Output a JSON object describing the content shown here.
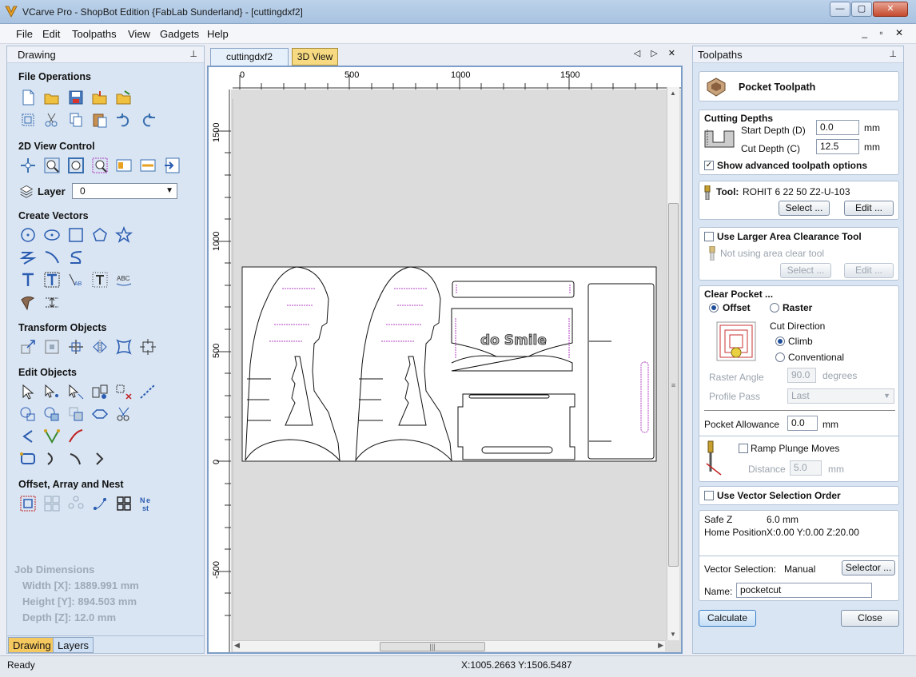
{
  "window": {
    "title": "VCarve Pro - ShopBot Edition {FabLab Sunderland} - [cuttingdxf2]",
    "min": "—",
    "max": "▢",
    "close": "✕"
  },
  "menu": [
    "File",
    "Edit",
    "Toolpaths",
    "View",
    "Gadgets",
    "Help"
  ],
  "mdi_controls": "_ ▫ ✕",
  "left_panel": {
    "title": "Drawing",
    "pin": "⊥",
    "sections": {
      "file": "File Operations",
      "view": "2D View Control",
      "vectors": "Create Vectors",
      "transform": "Transform Objects",
      "edit": "Edit Objects",
      "offset": "Offset, Array and Nest"
    },
    "layer_label": "Layer",
    "layer_value": "0",
    "job": {
      "title": "Job Dimensions",
      "width": "Width  [X]: 1889.991 mm",
      "height": "Height [Y]: 894.503 mm",
      "depth": "Depth  [Z]: 12.0 mm"
    },
    "tabs": [
      "Drawing",
      "Layers"
    ]
  },
  "doc": {
    "tabs": [
      "cuttingdxf2",
      "3D View"
    ],
    "nav": "◁ ▷ ✕",
    "ruler_top": [
      "0",
      "500",
      "1000",
      "1500"
    ],
    "ruler_left": [
      "1500",
      "1000",
      "500",
      "0",
      "-500"
    ],
    "design_text": "do Smile"
  },
  "right_panel": {
    "title": "Toolpaths",
    "header": "Pocket Toolpath",
    "cutting_depths": "Cutting Depths",
    "start_depth_label": "Start Depth (D)",
    "start_depth": "0.0",
    "cut_depth_label": "Cut Depth (C)",
    "cut_depth": "12.5",
    "unit_mm": "mm",
    "advanced": "Show advanced toolpath options",
    "tool_label": "Tool:",
    "tool_name": "ROHIT 6 22 50   Z2-U-103",
    "select_btn": "Select ...",
    "edit_btn": "Edit ...",
    "larger_area": "Use Larger Area Clearance Tool",
    "not_using": "Not using area clear tool",
    "clear_pocket": "Clear Pocket ...",
    "offset": "Offset",
    "raster": "Raster",
    "cut_direction": "Cut Direction",
    "climb": "Climb",
    "conventional": "Conventional",
    "raster_angle_label": "Raster Angle",
    "raster_angle": "90.0",
    "degrees": "degrees",
    "profile_pass_label": "Profile Pass",
    "profile_pass": "Last",
    "pocket_allowance_label": "Pocket Allowance",
    "pocket_allowance": "0.0",
    "ramp": "Ramp Plunge Moves",
    "distance_label": "Distance",
    "distance": "5.0",
    "vector_order": "Use Vector Selection Order",
    "safe_z_label": "Safe Z",
    "safe_z": "6.0 mm",
    "home_label": "Home Position",
    "home": "X:0.00 Y:0.00 Z:20.00",
    "vector_sel_label": "Vector Selection:",
    "vector_sel": "Manual",
    "selector_btn": "Selector ...",
    "name_label": "Name:",
    "name": "pocketcut",
    "calculate": "Calculate",
    "close": "Close"
  },
  "status": {
    "text": "Ready",
    "coords": "X:1005.2663 Y:1506.5487"
  },
  "colors": {
    "accent": "#f6c860",
    "panel": "#d9e5f3",
    "selection_dash": "#b040c0"
  }
}
